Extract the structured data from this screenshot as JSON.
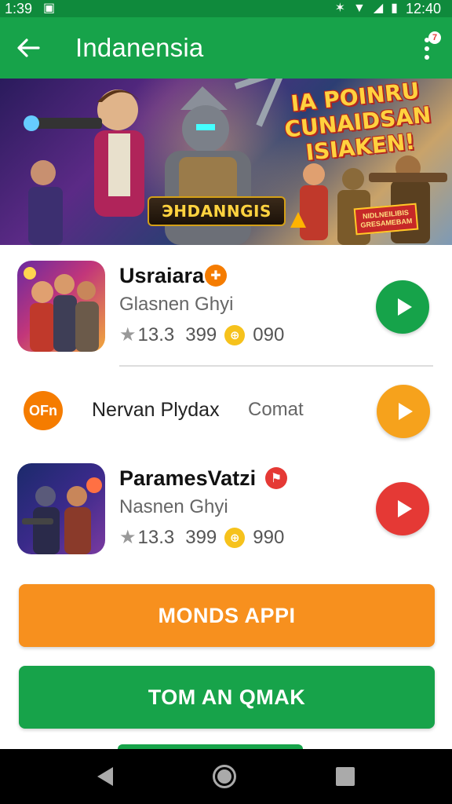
{
  "status_bar": {
    "time_left": "1:39",
    "time_right": "12:40"
  },
  "app_bar": {
    "title": "Indanensia",
    "menu_badge": "7"
  },
  "banner": {
    "headline_lines": [
      "IA POINRU",
      "CUNAIDSAN",
      "ISIAKEN!"
    ],
    "logo_text": "ЭHDANNGIS",
    "tag_text": "NIDLNEILIBIS GRESAMEBAM"
  },
  "apps": [
    {
      "name": "Usraiara",
      "developer": "Glasnen Ghyi",
      "rating": "13.3",
      "downloads": "399",
      "price": "090",
      "badge_color": "#f57c00",
      "play_color": "#16a34a"
    },
    {
      "name": "ParamesVatzi",
      "developer": "Nasnen Ghyi",
      "rating": "13.3",
      "downloads": "399",
      "price": "990",
      "badge_color": "#e53935",
      "play_color": "#e53935"
    }
  ],
  "promo": {
    "chip": "OFn",
    "text": "Nervan Plydax",
    "side": "Comat",
    "play_color": "#f6a21c"
  },
  "buttons": {
    "primary": "MONDS APPI",
    "secondary": "TOM AN QMAK"
  }
}
